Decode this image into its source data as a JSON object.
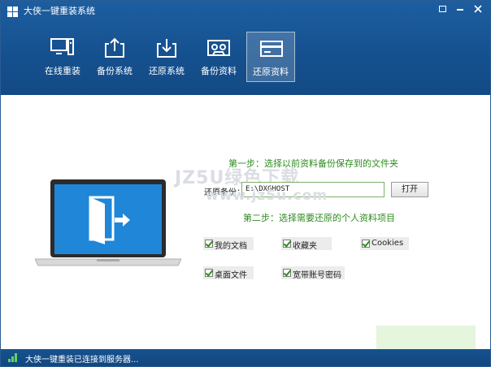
{
  "window": {
    "title": "大侠一键重装系统"
  },
  "tabs": [
    {
      "label": "在线重装",
      "icon": "monitor-icon"
    },
    {
      "label": "备份系统",
      "icon": "upload-icon"
    },
    {
      "label": "还原系统",
      "icon": "download-icon"
    },
    {
      "label": "备份资料",
      "icon": "tape-icon"
    },
    {
      "label": "还原资料",
      "icon": "card-icon",
      "active": true
    }
  ],
  "restore": {
    "step1": "第一步：选择以前资料备份保存到的文件夹",
    "path_label": "还原备份：",
    "path_value": "E:\\DXGHOST",
    "open_button": "打开",
    "step2": "第二步：选择需要还原的个人资料项目",
    "options": [
      {
        "label": "我的文档",
        "checked": true
      },
      {
        "label": "收藏夹",
        "checked": true
      },
      {
        "label": "Cookies",
        "checked": true
      },
      {
        "label": "桌面文件",
        "checked": true
      },
      {
        "label": "宽带账号密码",
        "checked": true
      }
    ]
  },
  "watermark": {
    "line1": "JZ5U绿色下载",
    "line2": "www.jz5u.com"
  },
  "status": {
    "text": "大侠一键重装已连接到服务器..."
  },
  "colors": {
    "header_blue": "#1a5797",
    "step_green": "#2d8b1e",
    "laptop_screen": "#1f86d8"
  }
}
